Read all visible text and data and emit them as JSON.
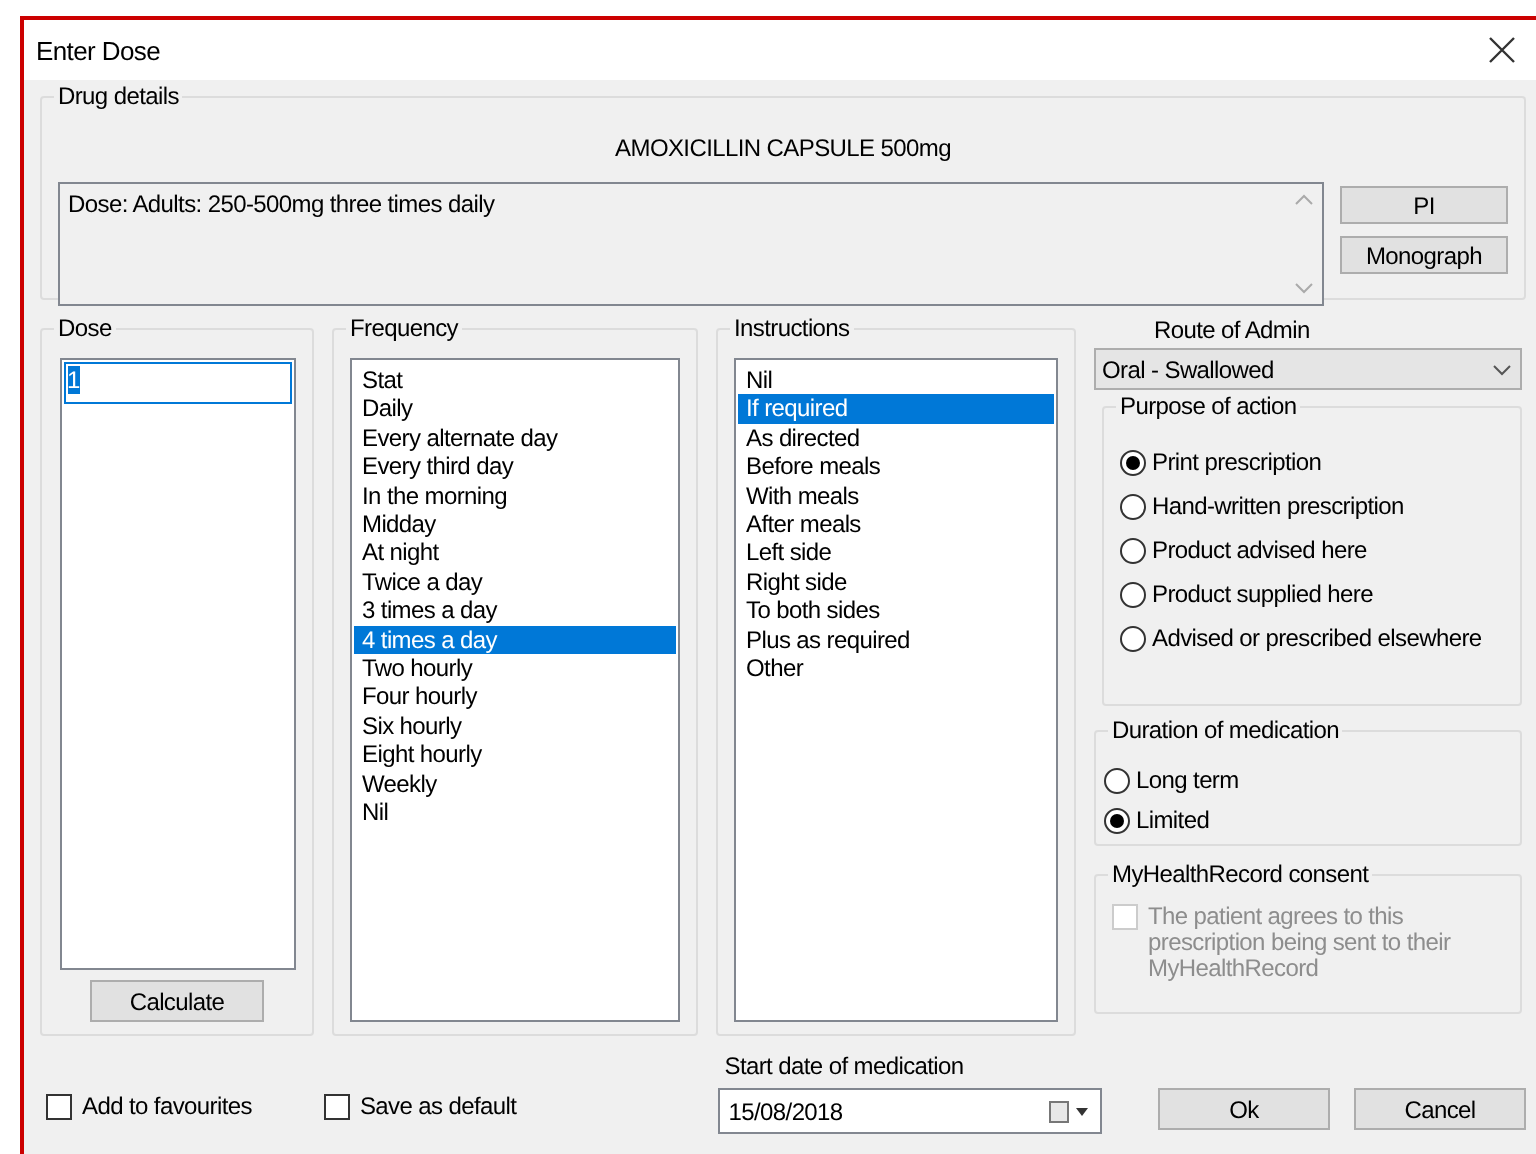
{
  "window": {
    "title": "Enter Dose"
  },
  "drug_details": {
    "label": "Drug details",
    "drug_name": "AMOXICILLIN CAPSULE 500mg",
    "dose_text": "Dose: Adults: 250-500mg three times daily",
    "buttons": [
      "PI",
      "Monograph"
    ]
  },
  "dose": {
    "label": "Dose",
    "value": "1",
    "button": "Calculate"
  },
  "frequency": {
    "label": "Frequency",
    "items": [
      {
        "label": "Stat",
        "selected": false
      },
      {
        "label": "Daily",
        "selected": false
      },
      {
        "label": "Every alternate day",
        "selected": false
      },
      {
        "label": "Every third day",
        "selected": false
      },
      {
        "label": "In the morning",
        "selected": false
      },
      {
        "label": "Midday",
        "selected": false
      },
      {
        "label": "At night",
        "selected": false
      },
      {
        "label": "Twice a day",
        "selected": false
      },
      {
        "label": "3 times a day",
        "selected": false
      },
      {
        "label": "4 times a day",
        "selected": true
      },
      {
        "label": "Two hourly",
        "selected": false
      },
      {
        "label": "Four hourly",
        "selected": false
      },
      {
        "label": "Six hourly",
        "selected": false
      },
      {
        "label": "Eight hourly",
        "selected": false
      },
      {
        "label": "Weekly",
        "selected": false
      },
      {
        "label": "Nil",
        "selected": false
      }
    ]
  },
  "instructions": {
    "label": "Instructions",
    "items": [
      {
        "label": "Nil",
        "selected": false
      },
      {
        "label": "If required",
        "selected": true
      },
      {
        "label": "As directed",
        "selected": false
      },
      {
        "label": "Before meals",
        "selected": false
      },
      {
        "label": "With meals",
        "selected": false
      },
      {
        "label": "After meals",
        "selected": false
      },
      {
        "label": "Left side",
        "selected": false
      },
      {
        "label": "Right side",
        "selected": false
      },
      {
        "label": "To both sides",
        "selected": false
      },
      {
        "label": "Plus as required",
        "selected": false
      },
      {
        "label": "Other",
        "selected": false
      }
    ]
  },
  "route": {
    "label": "Route of Admin",
    "value": "Oral - Swallowed"
  },
  "purpose": {
    "label": "Purpose of action",
    "options": [
      {
        "label": "Print prescription",
        "selected": true
      },
      {
        "label": "Hand-written prescription",
        "selected": false
      },
      {
        "label": "Product advised here",
        "selected": false
      },
      {
        "label": "Product supplied here",
        "selected": false
      },
      {
        "label": "Advised or prescribed elsewhere",
        "selected": false
      }
    ]
  },
  "duration": {
    "label": "Duration of medication",
    "options": [
      {
        "label": "Long term",
        "selected": false
      },
      {
        "label": "Limited",
        "selected": true
      }
    ]
  },
  "consent": {
    "label": "MyHealthRecord consent",
    "checkbox": {
      "label": "The patient agrees to this prescription being sent to their MyHealthRecord",
      "checked": false,
      "disabled": true
    }
  },
  "options": [
    {
      "label": "Add to favourites",
      "checked": false
    },
    {
      "label": "Save as default",
      "checked": false
    }
  ],
  "start_date": {
    "label": "Start date of medication",
    "value": "15/08/2018"
  },
  "buttons": [
    "Ok",
    "Cancel"
  ]
}
